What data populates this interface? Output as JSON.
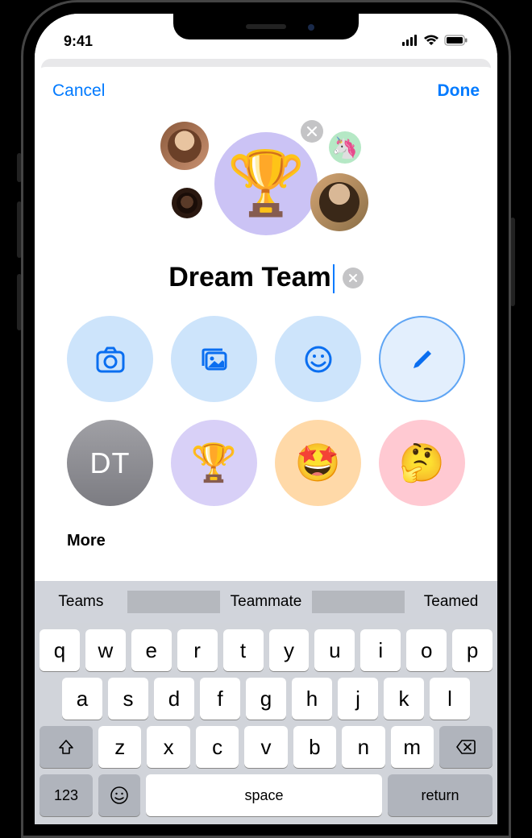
{
  "status": {
    "time": "9:41"
  },
  "header": {
    "cancel": "Cancel",
    "done": "Done"
  },
  "group": {
    "name": "Dream Team",
    "main_icon": "🏆",
    "member3_icon": "🦄"
  },
  "options": {
    "initials": "DT",
    "presets": {
      "trophy": "🏆",
      "starry": "🤩",
      "thinking": "🤔"
    }
  },
  "more_label": "More",
  "predictions": {
    "p1": "Teams",
    "p2": "Teammate",
    "p3": "Teamed"
  },
  "keys": {
    "r1": [
      "q",
      "w",
      "e",
      "r",
      "t",
      "y",
      "u",
      "i",
      "o",
      "p"
    ],
    "r2": [
      "a",
      "s",
      "d",
      "f",
      "g",
      "h",
      "j",
      "k",
      "l"
    ],
    "r3": [
      "z",
      "x",
      "c",
      "v",
      "b",
      "n",
      "m"
    ],
    "num": "123",
    "space": "space",
    "return": "return"
  }
}
